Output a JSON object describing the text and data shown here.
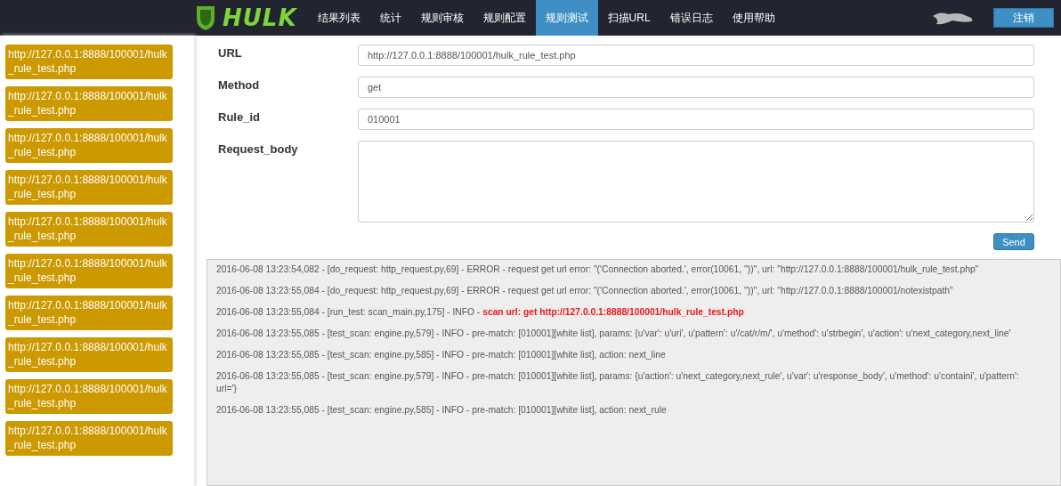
{
  "navbar": {
    "brand": "HULK",
    "items": [
      {
        "label": "结果列表",
        "selected": false
      },
      {
        "label": "统计",
        "selected": false
      },
      {
        "label": "规则审核",
        "selected": false
      },
      {
        "label": "规则配置",
        "selected": false
      },
      {
        "label": "规则测试",
        "selected": true
      },
      {
        "label": "扫描URL",
        "selected": false
      },
      {
        "label": "错误日志",
        "selected": false
      },
      {
        "label": "使用帮助",
        "selected": false
      }
    ],
    "logout": "注销"
  },
  "sidebar": {
    "items": [
      "http://127.0.0.1:8888/100001/hulk_rule_test.php",
      "http://127.0.0.1:8888/100001/hulk_rule_test.php",
      "http://127.0.0.1:8888/100001/hulk_rule_test.php",
      "http://127.0.0.1:8888/100001/hulk_rule_test.php",
      "http://127.0.0.1:8888/100001/hulk_rule_test.php",
      "http://127.0.0.1:8888/100001/hulk_rule_test.php",
      "http://127.0.0.1:8888/100001/hulk_rule_test.php",
      "http://127.0.0.1:8888/100001/hulk_rule_test.php",
      "http://127.0.0.1:8888/100001/hulk_rule_test.php",
      "http://127.0.0.1:8888/100001/hulk_rule_test.php"
    ]
  },
  "form": {
    "fields": [
      {
        "label": "URL",
        "kind": "input",
        "value": "http://127.0.0.1:8888/100001/hulk_rule_test.php"
      },
      {
        "label": "Method",
        "kind": "input",
        "value": "get"
      },
      {
        "label": "Rule_id",
        "kind": "input",
        "value": "010001"
      },
      {
        "label": "Request_body",
        "kind": "textarea"
      }
    ],
    "send": "Send"
  },
  "log": {
    "lines": [
      {
        "text": "2016-06-08 13:23:54,082 - [do_request: http_request.py,69] - ERROR - request get url error: \"('Connection aborted.', error(10061, ''))\", url: \"http://127.0.0.1:8888/100001/hulk_rule_test.php\""
      },
      {
        "text": "2016-06-08 13:23:55,084 - [do_request: http_request.py,69] - ERROR - request get url error: \"('Connection aborted.', error(10061, ''))\", url: \"http://127.0.0.1:8888/100001/notexistpath\""
      },
      {
        "text": "2016-06-08 13:23:55,084 - [run_test: scan_main.py,175] - INFO - ",
        "highlight": "scan url: get http://127.0.0.1:8888/100001/hulk_rule_test.php"
      },
      {
        "text": "2016-06-08 13:23:55,085 - [test_scan: engine.py,579] - INFO - pre-match: [010001][white list], params: {u'var': u'uri', u'pattern': u'/cat/r/m/', u'method': u'strbegin', u'action': u'next_category,next_line'"
      },
      {
        "text": "2016-06-08 13:23:55,085 - [test_scan: engine.py,585] - INFO - pre-match: [010001][white list], action: next_line"
      },
      {
        "text": "2016-06-08 13:23:55,085 - [test_scan: engine.py,579] - INFO - pre-match: [010001][white list], params: {u'action': u'next_category,next_rule', u'var': u'response_body', u'method': u'containi', u'pattern':",
        "cont": "url='}"
      },
      {
        "text": "2016-06-08 13:23:55,085 - [test_scan: engine.py,585] - INFO - pre-match: [010001][white list], action: next_rule"
      }
    ]
  }
}
